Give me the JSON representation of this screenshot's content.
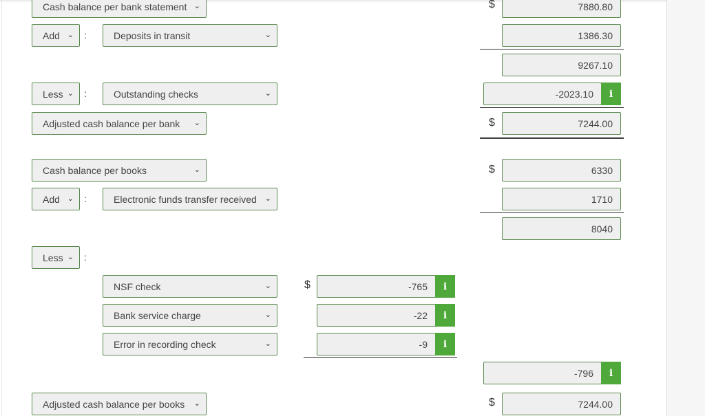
{
  "bank": {
    "start_label": "Cash balance per bank statement",
    "start_value": "7880.80",
    "add_op": "Add",
    "add_item": "Deposits in transit",
    "add_value": "1386.30",
    "subtotal": "9267.10",
    "less_op": "Less",
    "less_item": "Outstanding checks",
    "less_value": "-2023.10",
    "end_label": "Adjusted cash balance per bank",
    "end_value": "7244.00"
  },
  "books": {
    "start_label": "Cash balance per books",
    "start_value": "6330",
    "add_op": "Add",
    "add_item": "Electronic funds transfer received",
    "add_value": "1710",
    "subtotal": "8040",
    "less_op": "Less",
    "less_items": [
      {
        "label": "NSF check",
        "value": "-765"
      },
      {
        "label": "Bank service charge",
        "value": "-22"
      },
      {
        "label": "Error in recording check",
        "value": "-9"
      }
    ],
    "less_total": "-796",
    "end_label": "Adjusted cash balance per books",
    "end_value": "7244.00"
  },
  "symbols": {
    "dollar": "$",
    "colon": ":",
    "info": "i",
    "chevron": "⌄"
  },
  "colors": {
    "accent": "#4ea83a",
    "border": "#5a8a50"
  }
}
